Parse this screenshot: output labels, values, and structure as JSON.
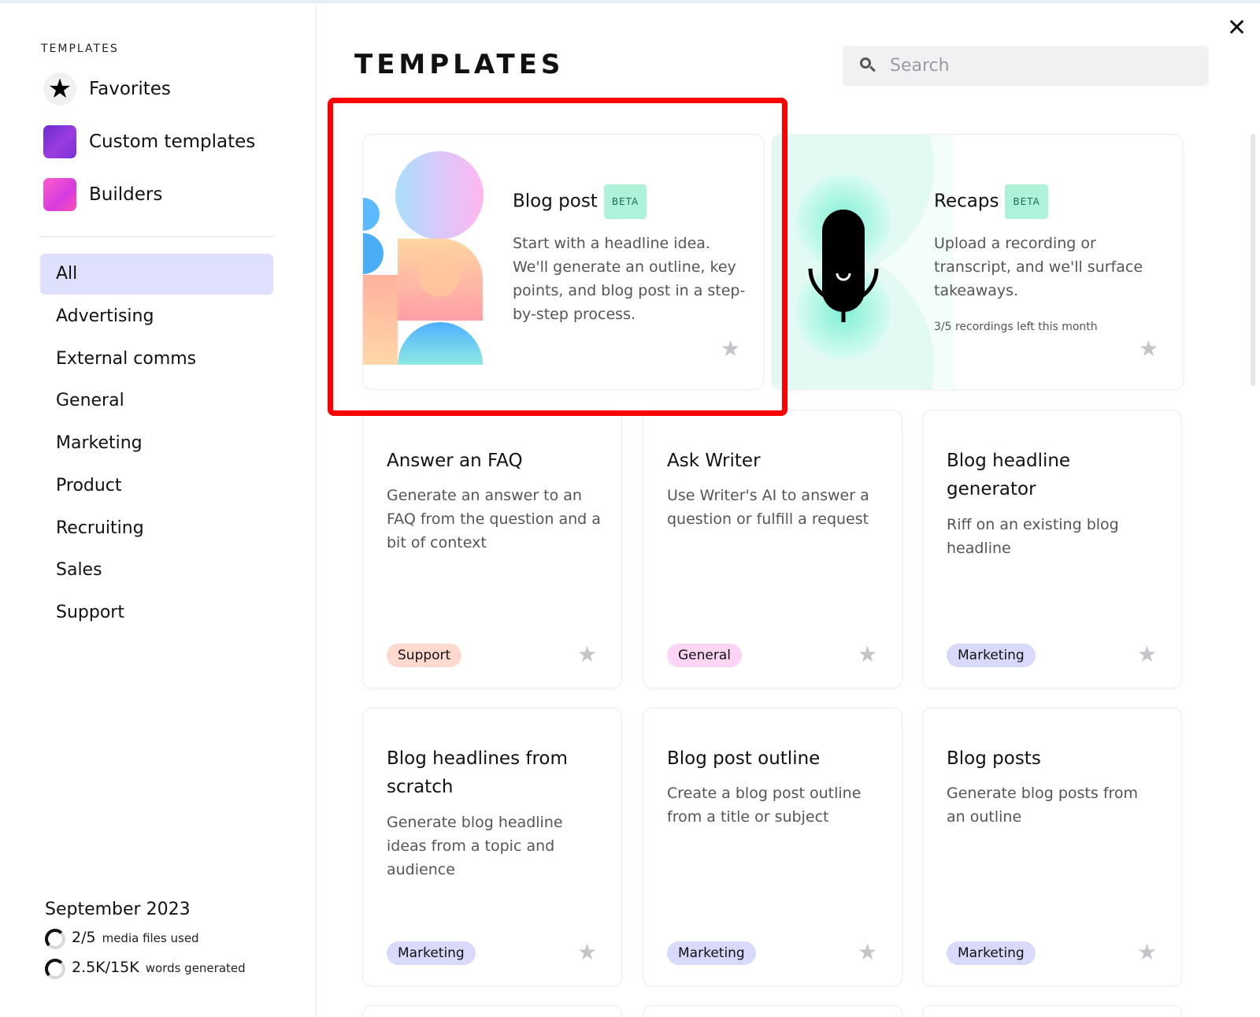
{
  "sidebar": {
    "caption": "TEMPLATES",
    "top_items": [
      {
        "label": "Favorites",
        "icon": "star-icon"
      },
      {
        "label": "Custom templates",
        "icon": "custom-templates-icon"
      },
      {
        "label": "Builders",
        "icon": "builders-icon"
      }
    ],
    "categories": [
      "All",
      "Advertising",
      "External comms",
      "General",
      "Marketing",
      "Product",
      "Recruiting",
      "Sales",
      "Support"
    ],
    "active_category": "All",
    "usage": {
      "period": "September 2023",
      "media": {
        "value": "2/5",
        "label": "media files used"
      },
      "words": {
        "value": "2.5K/15K",
        "label": "words generated"
      }
    }
  },
  "main": {
    "title": "TEMPLATES",
    "search": {
      "placeholder": "Search",
      "value": ""
    },
    "featured": [
      {
        "title": "Blog post",
        "badge": "BETA",
        "description": "Start with a headline idea. We'll generate an outline, key points, and blog post in a step-by-step process."
      },
      {
        "title": "Recaps",
        "badge": "BETA",
        "description": "Upload a recording or transcript, and we'll surface takeaways.",
        "note": "3/5 recordings left this month"
      }
    ],
    "cards": [
      {
        "title": "Answer an FAQ",
        "description": "Generate an answer to an FAQ from the question and a bit of context",
        "tag": "Support"
      },
      {
        "title": "Ask Writer",
        "description": "Use Writer's AI to answer a question or fulfill a request",
        "tag": "General"
      },
      {
        "title": "Blog headline generator",
        "description": "Riff on an existing blog headline",
        "tag": "Marketing"
      },
      {
        "title": "Blog headlines from scratch",
        "description": "Generate blog headline ideas from a topic and audience",
        "tag": "Marketing"
      },
      {
        "title": "Blog post outline",
        "description": "Create a blog post outline from a title or subject",
        "tag": "Marketing"
      },
      {
        "title": "Blog posts",
        "description": "Generate blog posts from an outline",
        "tag": "Marketing"
      }
    ]
  },
  "colors": {
    "active_category_bg": "#dfe0fb",
    "beta_badge_bg": "#aef2da",
    "tag_support": "#ffd9cf",
    "tag_general": "#fbd5f3",
    "tag_marketing": "#d8d9fb",
    "highlight": "#ff0000"
  }
}
